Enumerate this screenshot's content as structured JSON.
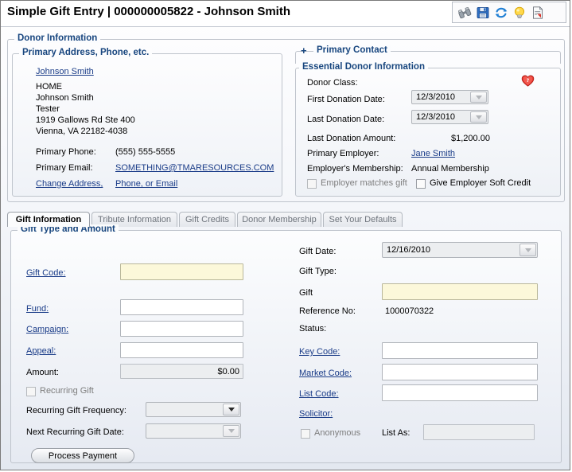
{
  "window": {
    "title": "Simple Gift Entry | 000000005822 - Johnson Smith"
  },
  "toolbar": {
    "icons": [
      {
        "name": "binoculars-icon",
        "label": "Find"
      },
      {
        "name": "save-icon",
        "label": "Save"
      },
      {
        "name": "refresh-icon",
        "label": "Refresh"
      },
      {
        "name": "lightbulb-icon",
        "label": "Hint"
      },
      {
        "name": "report-icon",
        "label": "Report"
      }
    ]
  },
  "donor_information": {
    "legend": "Donor Information",
    "primary_address": {
      "legend": "Primary Address, Phone, etc.",
      "name_link": "Johnson Smith",
      "address_lines": [
        "HOME",
        "Johnson Smith",
        "Tester",
        "1919 Gallows Rd Ste 400",
        "Vienna, VA 22182-4038"
      ],
      "phone_label": "Primary Phone:",
      "phone_value": "(555) 555-5555",
      "email_label": "Primary Email:",
      "email_value": "SOMETHING@TMARESOURCES.COM",
      "change_link_1": "Change Address,",
      "change_link_2": "Phone, or Email"
    },
    "primary_contact": {
      "expander": "+",
      "legend": "Primary Contact"
    },
    "essential_donor": {
      "legend": "Essential Donor Information",
      "donor_class_label": "Donor Class:",
      "donor_class_value": "",
      "first_donation_label": "First Donation Date:",
      "first_donation_value": "12/3/2010",
      "last_donation_label": "Last Donation Date:",
      "last_donation_value": "12/3/2010",
      "last_amount_label": "Last Donation Amount:",
      "last_amount_value": "$1,200.00",
      "employer_label": "Primary Employer:",
      "employer_value": "Jane Smith",
      "employer_membership_label": "Employer's Membership:",
      "employer_membership_value": "Annual Membership",
      "employer_matches_label": "Employer matches gift",
      "soft_credit_label": "Give Employer Soft Credit",
      "badge_icon": "heart-question-icon"
    }
  },
  "tabs": [
    {
      "label": "Gift Information",
      "active": true
    },
    {
      "label": "Tribute Information",
      "active": false
    },
    {
      "label": "Gift Credits",
      "active": false
    },
    {
      "label": "Donor Membership",
      "active": false
    },
    {
      "label": "Set Your Defaults",
      "active": false
    }
  ],
  "gift_type_and_amount": {
    "legend": "Gift Type and Amount",
    "left": {
      "gift_code_label": "Gift Code:",
      "gift_code_value": "",
      "fund_label": "Fund:",
      "fund_value": "",
      "campaign_label": "Campaign:",
      "campaign_value": "",
      "appeal_label": "Appeal:",
      "appeal_value": "",
      "amount_label": "Amount:",
      "amount_value": "$0.00",
      "recurring_gift_label": "Recurring Gift",
      "recurring_frequency_label": "Recurring Gift Frequency:",
      "recurring_frequency_value": "",
      "next_recurring_label": "Next Recurring Gift Date:",
      "next_recurring_value": "",
      "process_payment_label": "Process Payment"
    },
    "right": {
      "gift_date_label": "Gift Date:",
      "gift_date_value": "12/16/2010",
      "gift_type_label": "Gift Type:",
      "gift_type_value": "",
      "gift_label": "Gift",
      "gift_value": "",
      "reference_no_label": "Reference No:",
      "reference_no_value": "1000070322",
      "status_label": "Status:",
      "status_value": "",
      "key_code_label": "Key Code:",
      "key_code_value": "",
      "market_code_label": "Market Code:",
      "market_code_value": "",
      "list_code_label": "List Code:",
      "list_code_value": "",
      "solicitor_label": "Solicitor:",
      "anonymous_label": "Anonymous",
      "list_as_label": "List As:",
      "list_as_value": ""
    }
  },
  "colors": {
    "legend_blue": "#18467f",
    "link_blue": "#1a3c88",
    "required_yellow": "#fcf8da",
    "readonly_gray": "#eceef0",
    "border_gray": "#bfc4cc"
  }
}
